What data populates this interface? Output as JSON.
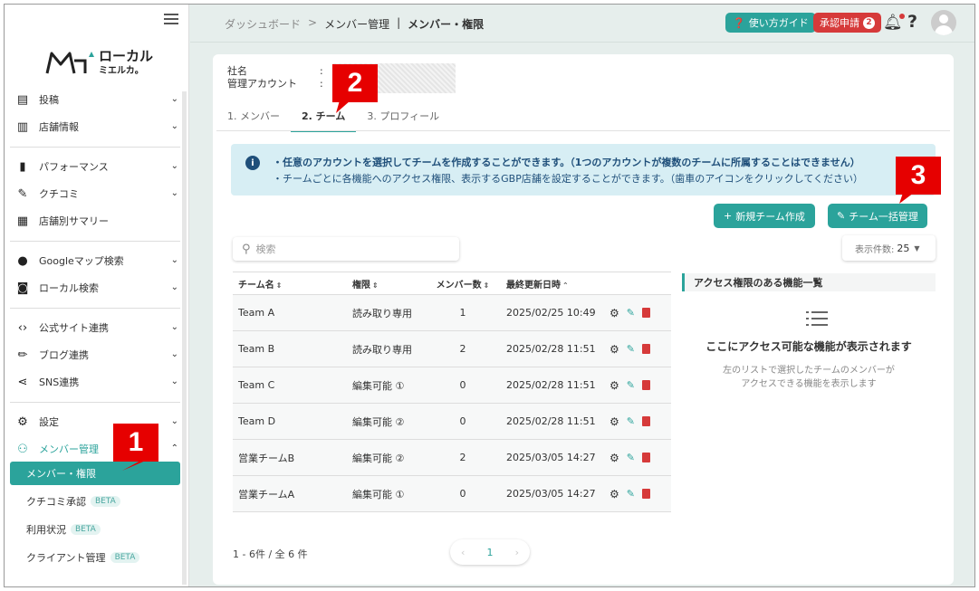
{
  "logo": {
    "name": "ローカル",
    "sub": "ミエルカ。"
  },
  "sidebar": {
    "items": [
      {
        "label": "投稿",
        "icon": "post-icon"
      },
      {
        "label": "店舗情報",
        "icon": "store-icon"
      },
      {
        "label": "パフォーマンス",
        "icon": "bar-chart-icon"
      },
      {
        "label": "クチコミ",
        "icon": "review-icon"
      },
      {
        "label": "店舗別サマリー",
        "icon": "store-summary-icon"
      },
      {
        "label": "Googleマップ検索",
        "icon": "map-pin-icon"
      },
      {
        "label": "ローカル検索",
        "icon": "local-search-icon"
      },
      {
        "label": "公式サイト連携",
        "icon": "code-icon"
      },
      {
        "label": "ブログ連携",
        "icon": "pencil-icon"
      },
      {
        "label": "SNS連携",
        "icon": "share-icon"
      },
      {
        "label": "設定",
        "icon": "gear-icon"
      },
      {
        "label": "メンバー管理",
        "icon": "members-icon"
      }
    ],
    "sub": [
      {
        "label": "メンバー・権限"
      },
      {
        "label": "クチコミ承認",
        "badge": "BETA"
      },
      {
        "label": "利用状況",
        "badge": "BETA"
      },
      {
        "label": "クライアント管理",
        "badge": "BETA"
      }
    ]
  },
  "header": {
    "breadcrumb": [
      "ダッシュボード",
      ">",
      "メンバー管理",
      "|",
      "メンバー・権限"
    ],
    "guide_label": "使い方ガイド",
    "approve_label": "承認申請",
    "approve_count": "2",
    "help": "?"
  },
  "main": {
    "company_label": "社名",
    "admin_label": "管理アカウント",
    "colon": ":",
    "tabs": [
      "1. メンバー",
      "2. チーム",
      "3. プロフィール"
    ],
    "info": {
      "line1": "・任意のアカウントを選択してチームを作成することができます。（1つのアカウントが複数のチームに所属することはできません）",
      "line2": "・チームごとに各機能へのアクセス権限、表示するGBP店舗を設定することができます。（歯車のアイコンをクリックしてください）"
    },
    "new_team_label": "新規チーム作成",
    "bulk_label": "チーム一括管理",
    "search_placeholder": "検索",
    "per_page_label": "表示件数:",
    "per_page_value": "25",
    "table": {
      "headers": [
        "チーム名",
        "権限",
        "メンバー数",
        "最終更新日時"
      ],
      "rows": [
        [
          "Team A",
          "読み取り専用",
          "1",
          "2025/02/25 10:49"
        ],
        [
          "Team B",
          "読み取り専用",
          "2",
          "2025/02/28 11:51"
        ],
        [
          "Team C",
          "編集可能 ①",
          "0",
          "2025/02/28 11:51"
        ],
        [
          "Team D",
          "編集可能 ②",
          "0",
          "2025/02/28 11:51"
        ],
        [
          "営業チームB",
          "編集可能 ②",
          "2",
          "2025/03/05 14:27"
        ],
        [
          "営業チームA",
          "編集可能 ①",
          "0",
          "2025/03/05 14:27"
        ]
      ]
    },
    "pager_info": "1 - 6件 / 全 6 件",
    "page": "1",
    "right_panel": {
      "title": "アクセス権限のある機能一覧",
      "empty_title": "ここにアクセス可能な機能が表示されます",
      "empty_sub1": "左のリストで選択したチームのメンバーが",
      "empty_sub2": "アクセスできる機能を表示します"
    }
  },
  "callouts": [
    "1",
    "2",
    "3"
  ],
  "colors": {
    "accent": "#2ba39b",
    "danger": "#d63a3a",
    "callout": "#e60000",
    "info_bg": "#d7eef4"
  }
}
